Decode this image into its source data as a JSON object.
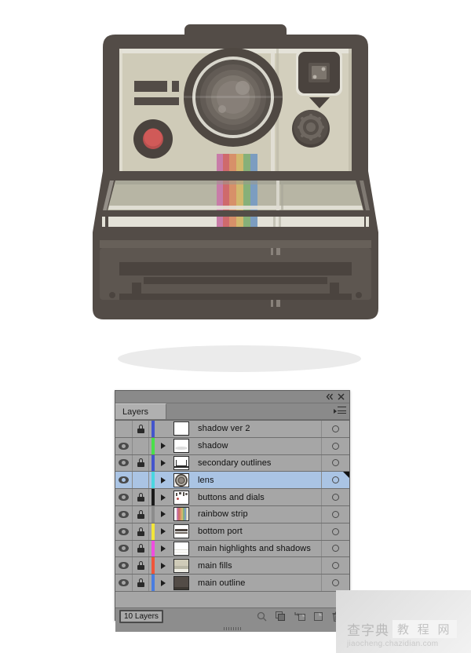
{
  "illustration": {
    "name": "polaroid-camera-illustration",
    "shadow_color": "#ebebeb",
    "palette": {
      "outline": "#534c47",
      "body_fill": "#cfcbb8",
      "body_fill_dark": "#b7b5a4",
      "highlight": "#e4e2d8",
      "lens_outer": "#4f4842",
      "lens_ring": "#d8d6cc",
      "lens_mid": "#6a635c",
      "lens_inner": "#7d766e",
      "lens_glint": "#8f8881",
      "red_button": "#d05a58",
      "red_button_ring": "#4a433e",
      "port_dark": "#4b443f",
      "port_mid": "#6d655e"
    },
    "rainbow": [
      "#c87ca8",
      "#cf6a6c",
      "#d79069",
      "#d2b86d",
      "#86b079",
      "#7c9dc0"
    ]
  },
  "panel": {
    "titlebar": {
      "collapse_label": "«",
      "close_label": "✕"
    },
    "tab_label": "Layers",
    "menu_icon": "panel-menu-icon",
    "columns": {
      "visibility": "eye-icon",
      "lock": "lock-icon",
      "expand": "disclosure-triangle",
      "thumbnail": "layer-thumbnail",
      "name": "layer-name",
      "target": "target-circle"
    },
    "layers": [
      {
        "name": "shadow ver 2",
        "visible": false,
        "locked": true,
        "expandable": false,
        "selected": false,
        "color": "#4455cc",
        "thumb": "blank-white"
      },
      {
        "name": "shadow",
        "visible": true,
        "locked": false,
        "expandable": true,
        "selected": false,
        "color": "#49e04a",
        "thumb": "shadow"
      },
      {
        "name": "secondary outlines",
        "visible": true,
        "locked": true,
        "expandable": true,
        "selected": false,
        "color": "#4455cc",
        "thumb": "outlines"
      },
      {
        "name": "lens",
        "visible": true,
        "locked": false,
        "expandable": true,
        "selected": true,
        "color": "#4ad6e0",
        "thumb": "lens"
      },
      {
        "name": "buttons and dials",
        "visible": true,
        "locked": true,
        "expandable": true,
        "selected": false,
        "color": "#1a1a1a",
        "thumb": "buttons"
      },
      {
        "name": "rainbow strip",
        "visible": true,
        "locked": true,
        "expandable": true,
        "selected": false,
        "color": "#8c8c8c",
        "thumb": "rainbow"
      },
      {
        "name": "bottom port",
        "visible": true,
        "locked": true,
        "expandable": true,
        "selected": false,
        "color": "#f2e53a",
        "thumb": "port"
      },
      {
        "name": "main highlights and shadows",
        "visible": true,
        "locked": true,
        "expandable": true,
        "selected": false,
        "color": "#ef4ce0",
        "thumb": "highlights"
      },
      {
        "name": "main fills",
        "visible": true,
        "locked": true,
        "expandable": true,
        "selected": false,
        "color": "#f0553a",
        "thumb": "fills"
      },
      {
        "name": "main outline",
        "visible": true,
        "locked": true,
        "expandable": true,
        "selected": false,
        "color": "#4a7de0",
        "thumb": "outline"
      }
    ],
    "footer": {
      "count_label": "10 Layers",
      "icons": [
        {
          "name": "locate-object-icon",
          "glyph": "search"
        },
        {
          "name": "clipping-mask-icon",
          "glyph": "mask"
        },
        {
          "name": "new-sublayer-icon",
          "glyph": "sublayer"
        },
        {
          "name": "new-layer-icon",
          "glyph": "newlayer"
        },
        {
          "name": "delete-layer-icon",
          "glyph": "trash"
        }
      ]
    }
  },
  "watermark": {
    "text_cn": "查字典",
    "text_box": "教 程 网",
    "url": "jiaocheng.chazidian.com"
  }
}
